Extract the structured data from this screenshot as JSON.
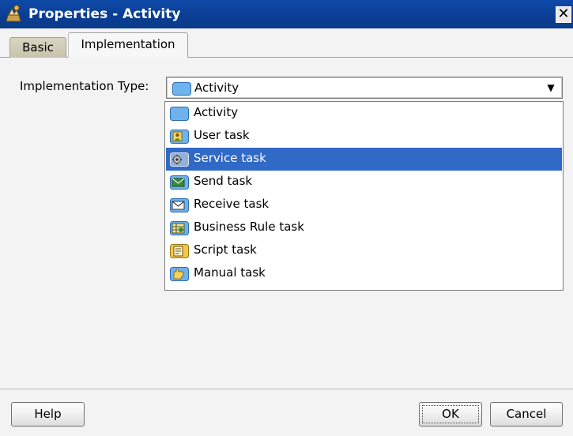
{
  "window": {
    "title": "Properties - Activity",
    "close_glyph": "✕"
  },
  "tabs": [
    {
      "label": "Basic",
      "active": false
    },
    {
      "label": "Implementation",
      "active": true
    }
  ],
  "form": {
    "implementation_type_label": "Implementation Type:",
    "implementation_type_value": "Activity",
    "implementation_type_icon": "activity-icon",
    "dropdown_arrow": "▼"
  },
  "dropdown": {
    "options": [
      {
        "label": "Activity",
        "icon": "activity-icon",
        "selected": false
      },
      {
        "label": "User task",
        "icon": "user-task-icon",
        "selected": false
      },
      {
        "label": "Service task",
        "icon": "service-task-icon",
        "selected": true
      },
      {
        "label": "Send task",
        "icon": "send-task-icon",
        "selected": false
      },
      {
        "label": "Receive task",
        "icon": "receive-task-icon",
        "selected": false
      },
      {
        "label": "Business Rule task",
        "icon": "business-rule-task-icon",
        "selected": false
      },
      {
        "label": "Script task",
        "icon": "script-task-icon",
        "selected": false
      },
      {
        "label": "Manual task",
        "icon": "manual-task-icon",
        "selected": false
      }
    ]
  },
  "buttons": {
    "help": "Help",
    "ok": "OK",
    "cancel": "Cancel"
  },
  "colors": {
    "titlebar": "#0a3d92",
    "selection": "#3169c6",
    "task_icon_fill": "#5da3e0"
  }
}
